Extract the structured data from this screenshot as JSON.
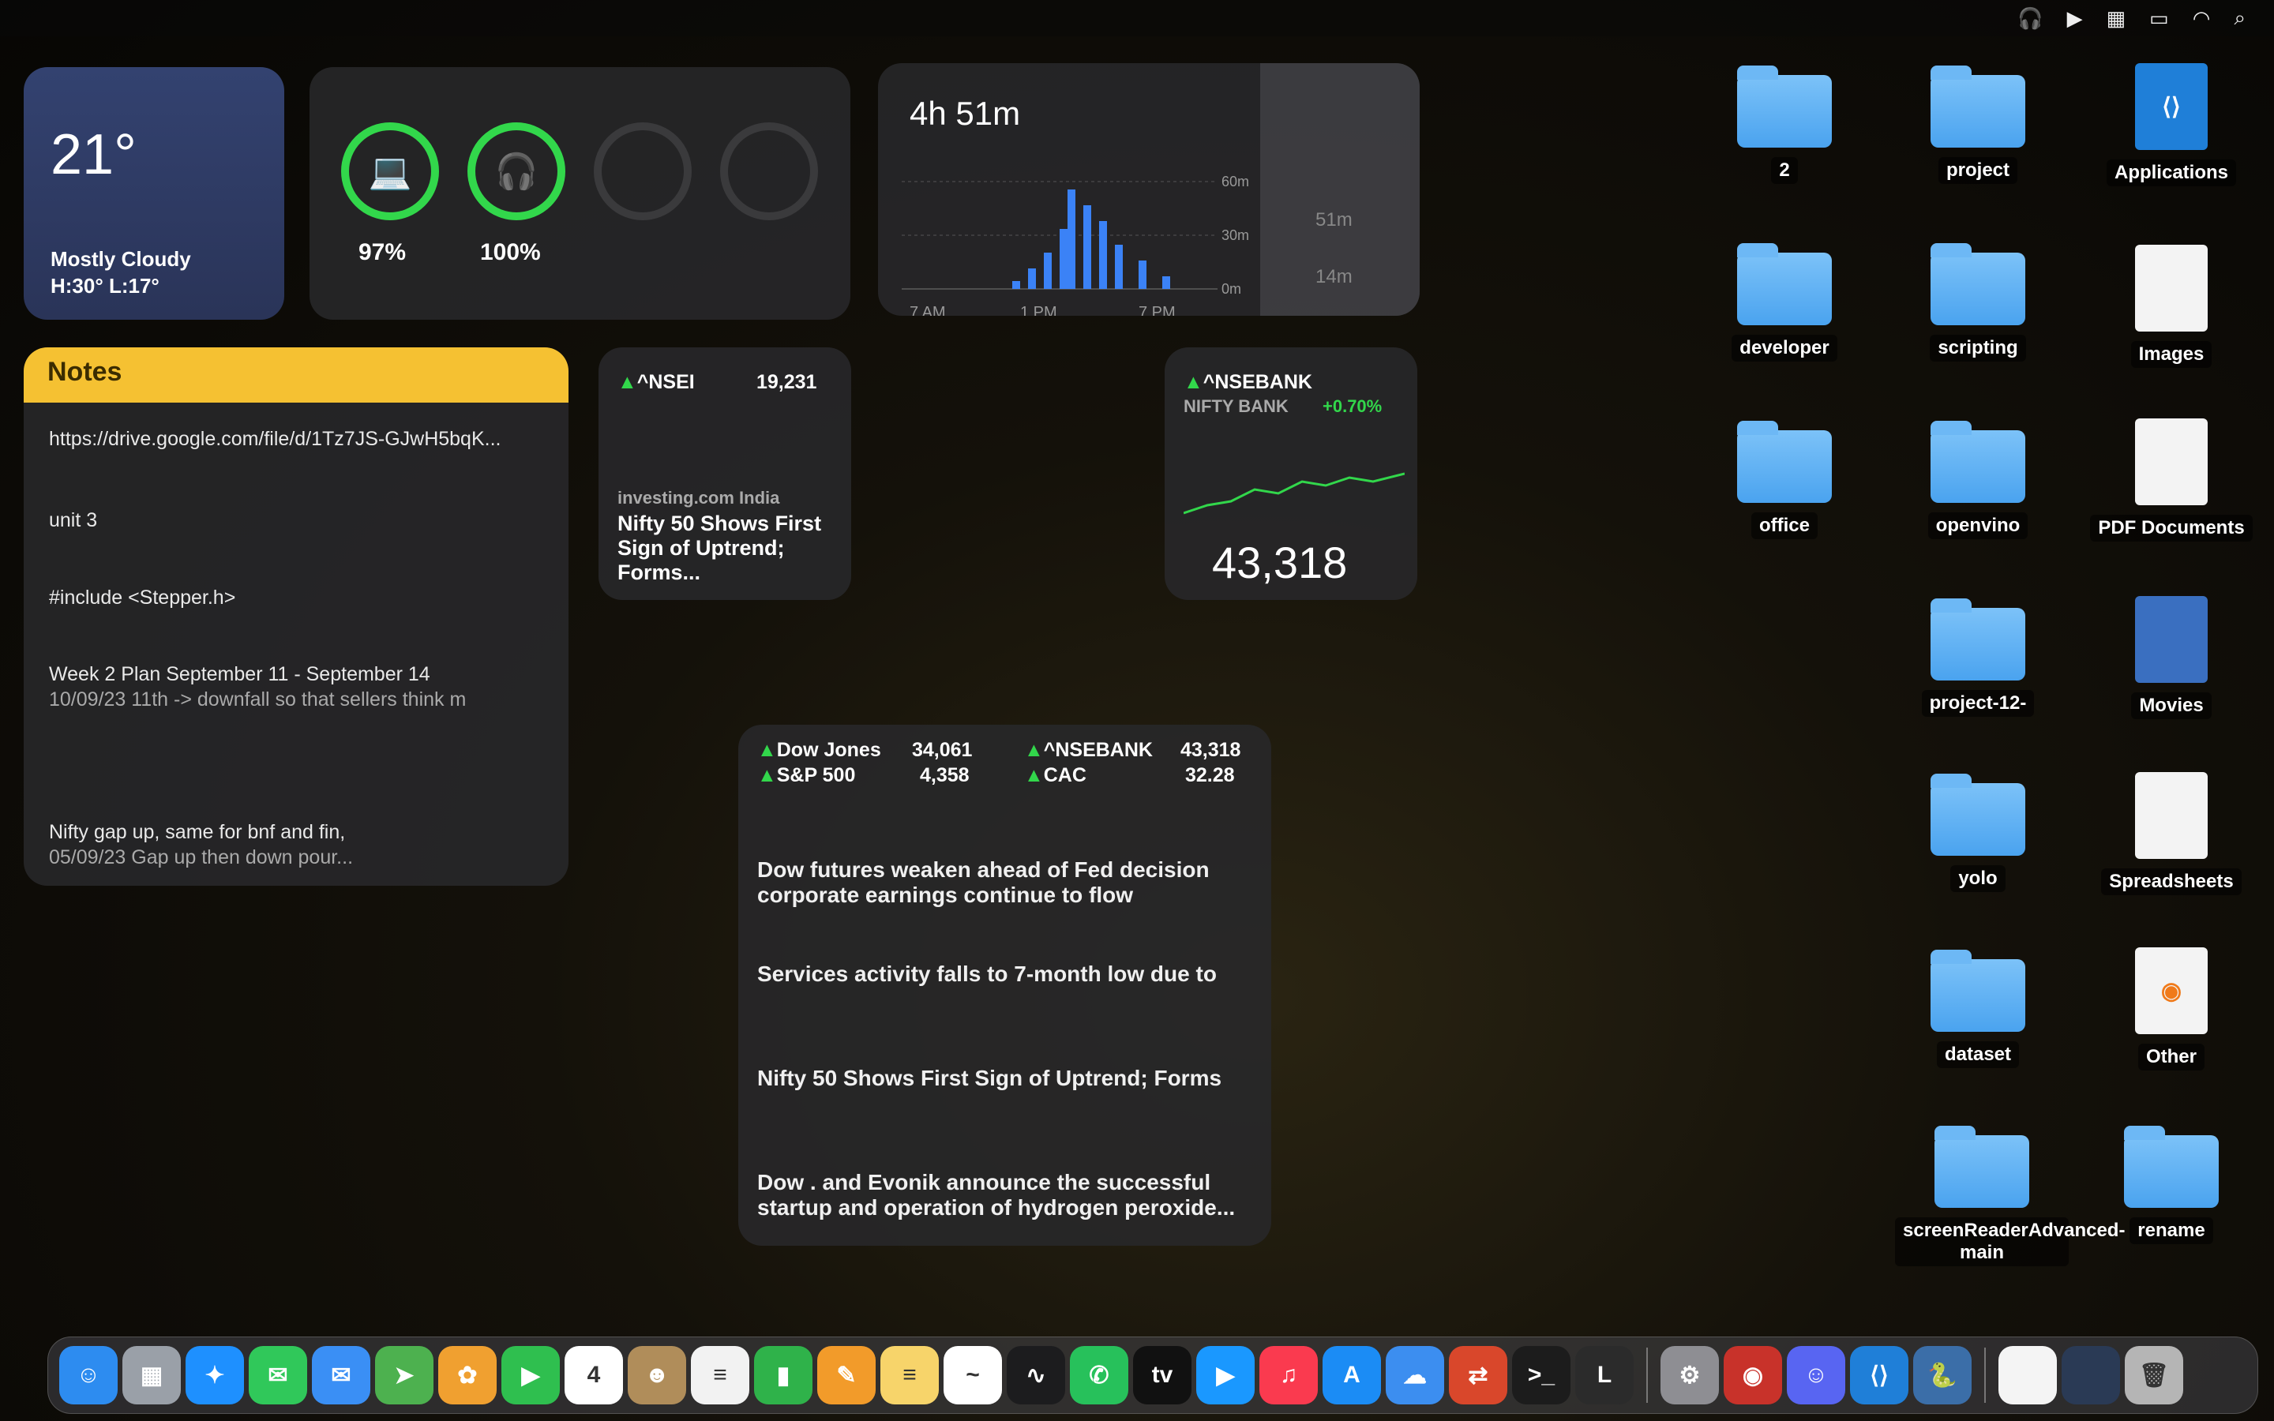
{
  "menubar": {
    "icons": [
      "apple-icon",
      "headphones-icon",
      "play-icon",
      "calendar-icon",
      "battery-icon",
      "wifi-icon",
      "search-icon"
    ]
  },
  "weather": {
    "temp": "21°",
    "condition": "Mostly Cloudy",
    "high_low": "H:30° L:17°"
  },
  "batteries": [
    {
      "icon": "laptop-icon",
      "percent": "97%"
    },
    {
      "icon": "headphones-icon",
      "percent": "100%"
    },
    {
      "icon": "empty",
      "percent": ""
    },
    {
      "icon": "empty",
      "percent": ""
    }
  ],
  "screentime": {
    "total": "4h 51m",
    "y_labels": [
      "60m",
      "30m",
      "0m"
    ],
    "x_labels": [
      "7 AM",
      "1 PM",
      "7 PM"
    ],
    "side_times": [
      "51m",
      "14m"
    ]
  },
  "notes": {
    "title": "Notes",
    "lines": [
      "https://drive.google.com/file/d/1Tz7JS-GJwH5bqK...",
      "unit 3",
      "#include <Stepper.h>",
      "Week 2 Plan September 11 - September 14",
      "10/09/23  11th -> downfall so that sellers think m",
      "Nifty gap up, same for bnf and fin,",
      "05/09/23  Gap up then down pour..."
    ]
  },
  "stocks1": {
    "symbol": "^NSEI",
    "value": "19,231",
    "source": "investing.com India",
    "headline": "Nifty 50 Shows First Sign of Uptrend; Forms..."
  },
  "stocks2": {
    "symbol": "^NSEBANK",
    "name": "NIFTY BANK",
    "change": "+0.70%",
    "value": "43,318"
  },
  "stocks3": {
    "rows": [
      {
        "sym": "Dow Jones",
        "val": "34,061"
      },
      {
        "sym": "S&P 500",
        "val": "4,358"
      },
      {
        "sym": "^NSEBANK",
        "val": "43,318"
      },
      {
        "sym": "CAC",
        "val": "32.28"
      }
    ],
    "news": [
      "Dow futures weaken ahead of Fed decision corporate earnings continue to flow",
      "Services activity falls to 7-month low due to",
      "Nifty 50 Shows First Sign of Uptrend; Forms",
      "Dow . and Evonik announce the successful startup and operation of hydrogen peroxide..."
    ]
  },
  "desktop": {
    "items": [
      {
        "label": "2",
        "type": "folder"
      },
      {
        "label": "project",
        "type": "folder"
      },
      {
        "label": "Applications",
        "type": "app"
      },
      {
        "label": "developer",
        "type": "folder"
      },
      {
        "label": "scripting",
        "type": "folder"
      },
      {
        "label": "Images",
        "type": "file"
      },
      {
        "label": "office",
        "type": "folder"
      },
      {
        "label": "openvino",
        "type": "folder"
      },
      {
        "label": "PDF Documents",
        "type": "file"
      },
      {
        "label": "project-12-",
        "type": "folder"
      },
      {
        "label": "Movies",
        "type": "file"
      },
      {
        "label": "yolo",
        "type": "folder"
      },
      {
        "label": "Spreadsheets",
        "type": "file"
      },
      {
        "label": "dataset",
        "type": "folder"
      },
      {
        "label": "Other",
        "type": "file"
      },
      {
        "label": "screenReaderAdvanced-main",
        "type": "folder"
      },
      {
        "label": "rename",
        "type": "folder"
      }
    ]
  },
  "dock": {
    "apps": [
      {
        "name": "Finder",
        "color": "#2d8cf0",
        "glyph": "☺"
      },
      {
        "name": "Launchpad",
        "color": "#9aa0a8",
        "glyph": "▦"
      },
      {
        "name": "Safari",
        "color": "#1e90ff",
        "glyph": "✦"
      },
      {
        "name": "Messages",
        "color": "#30c85a",
        "glyph": "✉"
      },
      {
        "name": "Mail",
        "color": "#3a8ff5",
        "glyph": "✉"
      },
      {
        "name": "Maps",
        "color": "#4db14f",
        "glyph": "➤"
      },
      {
        "name": "Photos",
        "color": "#f0a030",
        "glyph": "✿"
      },
      {
        "name": "FaceTime",
        "color": "#2fbf4f",
        "glyph": "▶"
      },
      {
        "name": "Calendar",
        "color": "#ffffff",
        "glyph": "4"
      },
      {
        "name": "Contacts",
        "color": "#b08d5a",
        "glyph": "☻"
      },
      {
        "name": "Reminders",
        "color": "#f2f2f2",
        "glyph": "≡"
      },
      {
        "name": "Numbers",
        "color": "#2fb24a",
        "glyph": "▮"
      },
      {
        "name": "Pages",
        "color": "#f29b2a",
        "glyph": "✎"
      },
      {
        "name": "Notes",
        "color": "#f7d46a",
        "glyph": "≡"
      },
      {
        "name": "Freeform",
        "color": "#ffffff",
        "glyph": "~"
      },
      {
        "name": "Stocks",
        "color": "#1c1c1e",
        "glyph": "∿"
      },
      {
        "name": "WhatsApp",
        "color": "#27c15b",
        "glyph": "✆"
      },
      {
        "name": "TV",
        "color": "#111111",
        "glyph": "tv"
      },
      {
        "name": "Prime Video",
        "color": "#1a98ff",
        "glyph": "▶"
      },
      {
        "name": "Music",
        "color": "#fa3a4f",
        "glyph": "♫"
      },
      {
        "name": "App Store",
        "color": "#1b8cf5",
        "glyph": "A"
      },
      {
        "name": "Weather",
        "color": "#3c8ef0",
        "glyph": "☁"
      },
      {
        "name": "Remote Desktop",
        "color": "#d9472b",
        "glyph": "⇄"
      },
      {
        "name": "Terminal",
        "color": "#1c1c1c",
        "glyph": ">_"
      },
      {
        "name": "L",
        "color": "#2b2b2b",
        "glyph": "L"
      },
      {
        "name": "sep",
        "color": "",
        "glyph": ""
      },
      {
        "name": "System Settings",
        "color": "#8e8e93",
        "glyph": "⚙"
      },
      {
        "name": "Photo Booth",
        "color": "#c8322a",
        "glyph": "◉"
      },
      {
        "name": "Discord",
        "color": "#5865f2",
        "glyph": "☺"
      },
      {
        "name": "VS Code",
        "color": "#1f7fd8",
        "glyph": "⟨⟩"
      },
      {
        "name": "Python",
        "color": "#3b6ea8",
        "glyph": "🐍"
      },
      {
        "name": "sep",
        "color": "",
        "glyph": ""
      },
      {
        "name": "Document",
        "color": "#f4f4f4",
        "glyph": ""
      },
      {
        "name": "Window",
        "color": "#2a3a55",
        "glyph": ""
      },
      {
        "name": "Trash",
        "color": "#b5b5b5",
        "glyph": "🗑"
      }
    ]
  }
}
